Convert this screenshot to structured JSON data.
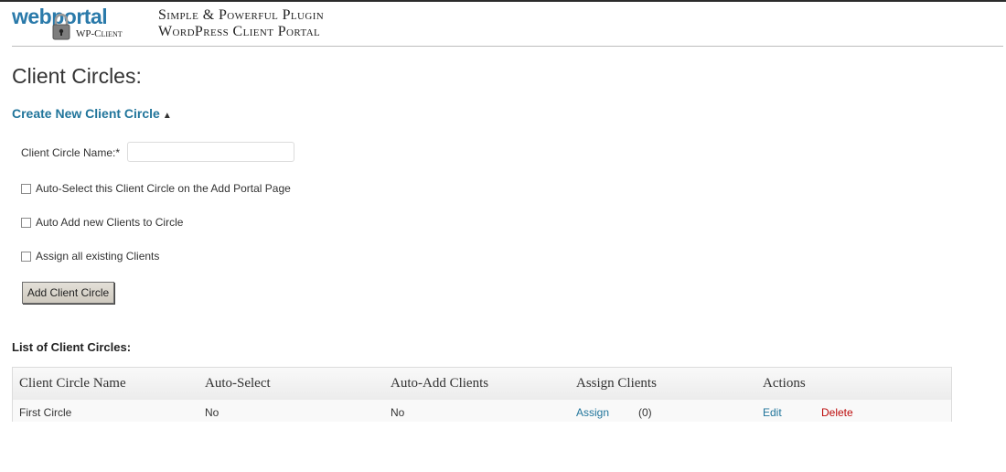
{
  "header": {
    "logo_text": "webportal",
    "logo_sub": "WP-Client",
    "tagline_line1": "Simple & Powerful Plugin",
    "tagline_line2": "WordPress Client Portal"
  },
  "page_title": "Client Circles:",
  "create_section": {
    "toggle_label": "Create New Client Circle",
    "toggle_arrow": "▲",
    "name_label": "Client Circle Name:*",
    "name_value": "",
    "checkboxes": [
      {
        "label": "Auto-Select this Client Circle on the Add Portal Page",
        "checked": false
      },
      {
        "label": "Auto Add new Clients to Circle",
        "checked": false
      },
      {
        "label": "Assign all existing Clients",
        "checked": false
      }
    ],
    "submit_label": "Add Client Circle"
  },
  "list": {
    "title": "List of Client Circles:",
    "columns": [
      "Client Circle Name",
      "Auto-Select",
      "Auto-Add Clients",
      "Assign Clients",
      "Actions"
    ],
    "rows": [
      {
        "name": "First Circle",
        "auto_select": "No",
        "auto_add": "No",
        "assign_label": "Assign",
        "assign_count": "(0)",
        "edit_label": "Edit",
        "delete_label": "Delete"
      }
    ]
  },
  "colors": {
    "link": "#21759b",
    "delete": "#bc0b0b",
    "logo": "#2a7aaa"
  },
  "icons": [
    "lock-icon",
    "checkbox-icon"
  ]
}
